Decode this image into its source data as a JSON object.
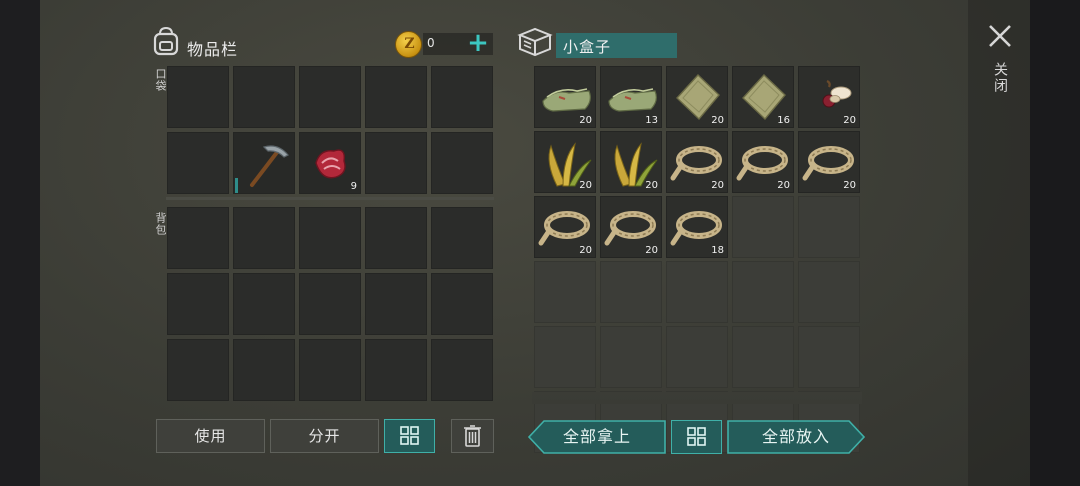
{
  "inventory": {
    "title": "物品栏",
    "coins": "0",
    "pocket_label": "口袋",
    "backpack_label": "背包",
    "pocket_slots": [
      {
        "item": "",
        "count": ""
      },
      {
        "item": "",
        "count": ""
      },
      {
        "item": "",
        "count": ""
      },
      {
        "item": "",
        "count": ""
      },
      {
        "item": "",
        "count": ""
      },
      {
        "item": "",
        "count": ""
      },
      {
        "item": "pickaxe-icon",
        "count": "",
        "durability": 0.3
      },
      {
        "item": "raw-meat-icon",
        "count": "9"
      },
      {
        "item": "",
        "count": ""
      },
      {
        "item": "",
        "count": ""
      }
    ],
    "backpack_rows": 3,
    "buttons": {
      "use": "使用",
      "split": "分开"
    }
  },
  "container": {
    "name": "小盒子",
    "slots": [
      {
        "item": "cloth-icon",
        "count": "20"
      },
      {
        "item": "cloth-icon",
        "count": "13"
      },
      {
        "item": "leather-icon",
        "count": "20"
      },
      {
        "item": "leather-icon",
        "count": "16"
      },
      {
        "item": "seeds-icon",
        "count": "20"
      },
      {
        "item": "plant-fiber-icon",
        "count": "20"
      },
      {
        "item": "plant-fiber-icon",
        "count": "20"
      },
      {
        "item": "rope-icon",
        "count": "20"
      },
      {
        "item": "rope-icon",
        "count": "20"
      },
      {
        "item": "rope-icon",
        "count": "20"
      },
      {
        "item": "rope-icon",
        "count": "20"
      },
      {
        "item": "rope-icon",
        "count": "20"
      },
      {
        "item": "rope-icon",
        "count": "18"
      }
    ],
    "buttons": {
      "take_all": "全部拿上",
      "put_all": "全部放入"
    }
  },
  "close_label": "关闭",
  "colors": {
    "accent": "#3fb0a8",
    "teal_dark": "#245c5a",
    "box_name_bg": "#2f6d6b",
    "slot_bg": "#2b2c2a"
  }
}
